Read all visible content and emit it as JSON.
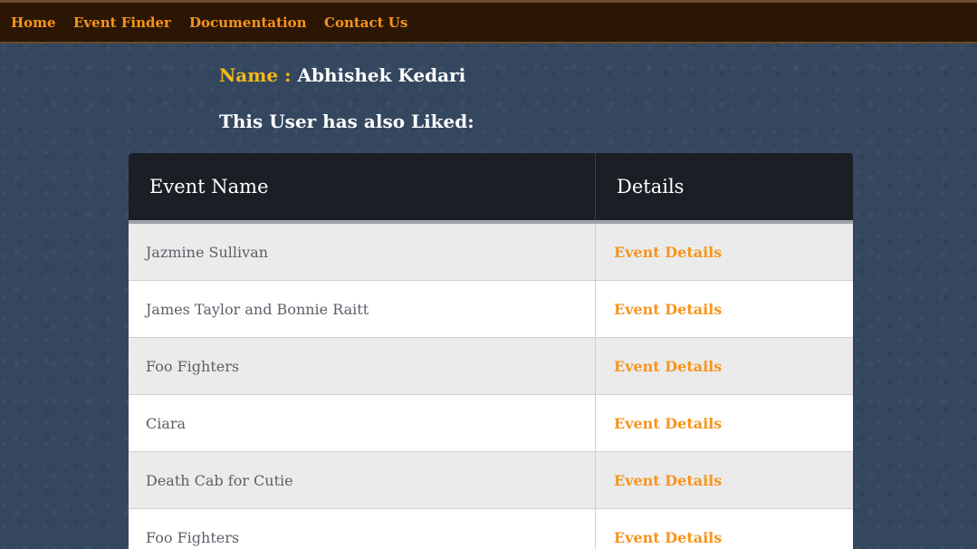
{
  "nav": {
    "home": "Home",
    "event_finder": "Event Finder",
    "documentation": "Documentation",
    "contact_us": "Contact Us"
  },
  "profile": {
    "name_label": "Name :",
    "name_value": "Abhishek Kedari",
    "liked_heading": "This User has also Liked:"
  },
  "table": {
    "headers": [
      "Event Name",
      "Details"
    ],
    "rows": [
      {
        "event_name": "Jazmine Sullivan",
        "details": "Event Details"
      },
      {
        "event_name": "James Taylor and Bonnie Raitt",
        "details": "Event Details"
      },
      {
        "event_name": "Foo Fighters",
        "details": "Event Details"
      },
      {
        "event_name": "Ciara",
        "details": "Event Details"
      },
      {
        "event_name": "Death Cab for Cutie",
        "details": "Event Details"
      },
      {
        "event_name": "Foo Fighters",
        "details": "Event Details"
      }
    ]
  },
  "colors": {
    "nav_background": "#2a1603",
    "accent_orange": "#f7941d",
    "name_label_yellow": "#f5b81c",
    "page_background": "#34475f",
    "table_header_background": "#1b1e25"
  }
}
